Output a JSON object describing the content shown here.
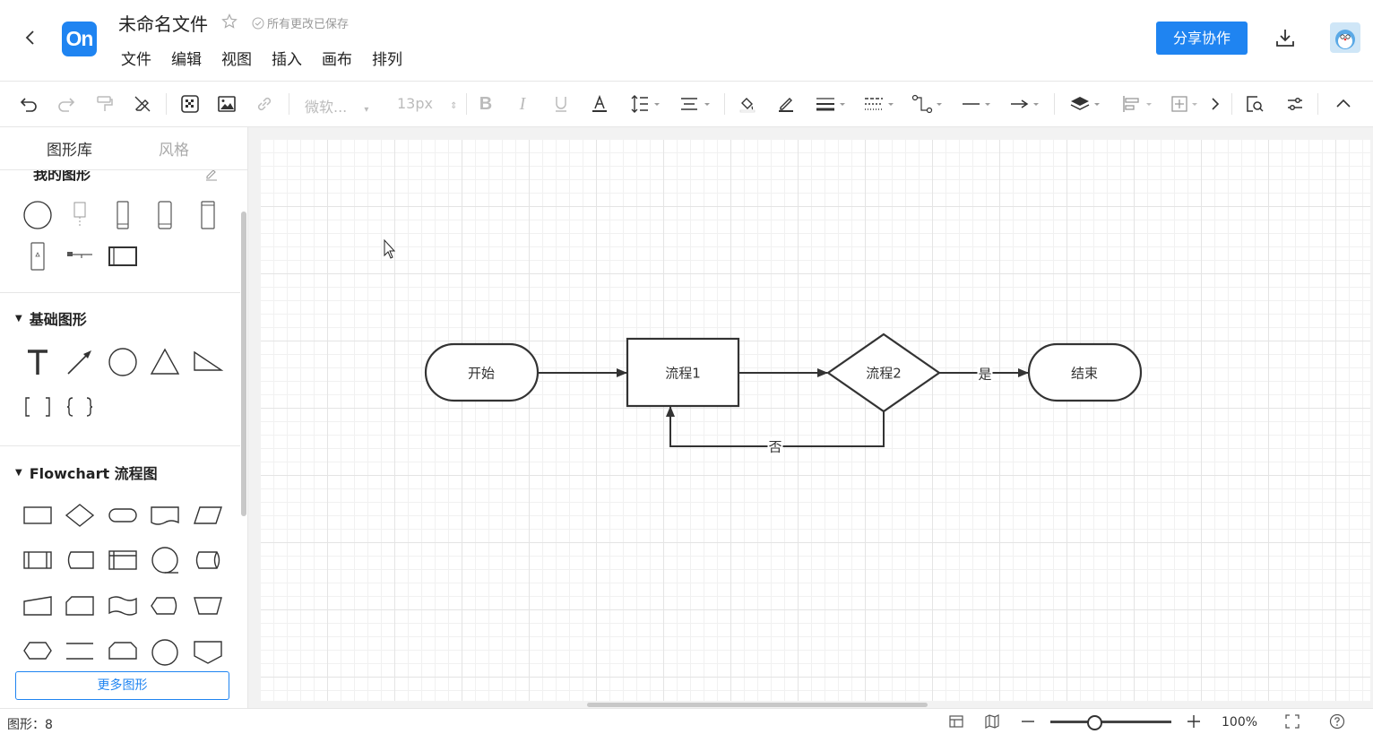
{
  "header": {
    "logo_text": "On",
    "title": "未命名文件",
    "save_status": "所有更改已保存",
    "menu": [
      "文件",
      "编辑",
      "视图",
      "插入",
      "画布",
      "排列"
    ],
    "share_label": "分享协作"
  },
  "toolbar": {
    "font_family": "微软...",
    "font_size": "13px",
    "icons": [
      "undo-icon",
      "redo-icon",
      "format-painter-icon",
      "clear-format-icon",
      "texture-icon",
      "image-icon",
      "link-icon",
      "bold-icon",
      "italic-icon",
      "underline-icon",
      "font-color-icon",
      "line-height-icon",
      "align-icon",
      "fill-color-icon",
      "line-color-icon",
      "line-width-icon",
      "line-style-icon",
      "connector-icon",
      "line-type-icon",
      "arrow-icon",
      "layer-icon",
      "align-distribute-icon",
      "size-icon",
      "more-icon",
      "find-icon",
      "settings-icon",
      "collapse-icon"
    ]
  },
  "sidebar": {
    "tabs": [
      "图形库",
      "风格"
    ],
    "my_shapes_title": "我的图形",
    "basic_title": "基础图形",
    "flowchart_title": "Flowchart 流程图",
    "more_button": "更多图形"
  },
  "diagram": {
    "nodes": [
      {
        "id": "start",
        "label": "开始",
        "shape": "terminator"
      },
      {
        "id": "p1",
        "label": "流程1",
        "shape": "process"
      },
      {
        "id": "p2",
        "label": "流程2",
        "shape": "decision"
      },
      {
        "id": "end",
        "label": "结束",
        "shape": "terminator"
      }
    ],
    "edges": [
      {
        "from": "start",
        "to": "p1",
        "label": ""
      },
      {
        "from": "p1",
        "to": "p2",
        "label": ""
      },
      {
        "from": "p2",
        "to": "end",
        "label": "是"
      },
      {
        "from": "p2",
        "to": "p1",
        "label": "否"
      }
    ]
  },
  "status": {
    "shape_count": "图形：8",
    "zoom": "100%"
  },
  "colors": {
    "accent": "#1f84f1",
    "stroke": "#333333"
  }
}
